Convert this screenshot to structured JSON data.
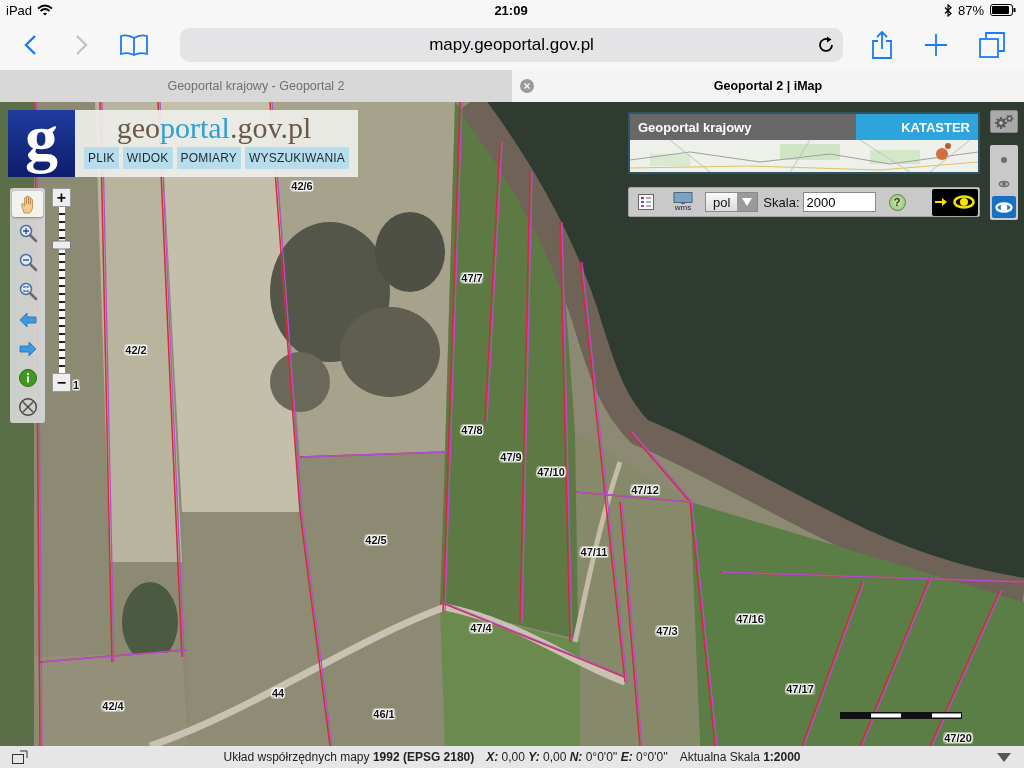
{
  "status_bar": {
    "device": "iPad",
    "time": "21:09",
    "battery": "87%"
  },
  "browser": {
    "left_buttons": [
      {
        "kind": "back",
        "disabled": false
      },
      {
        "kind": "forward",
        "disabled": true
      },
      {
        "kind": "bookmarks",
        "disabled": false
      }
    ],
    "address": "mapy.geoportal.gov.pl",
    "right_buttons": [
      {
        "kind": "share"
      },
      {
        "kind": "new_tab"
      },
      {
        "kind": "tabs"
      }
    ]
  },
  "tabs": [
    {
      "label": "Geoportal krajowy - Geoportal 2",
      "selected": false
    },
    {
      "label": "Geoportal 2 | iMap",
      "selected": true
    }
  ],
  "map": {
    "logo": {
      "mark": "g",
      "wordmark": [
        "geo",
        "portal",
        ".gov.pl"
      ]
    },
    "menu": [
      "PLIK",
      "WIDOK",
      "POMIARY",
      "WYSZUKIWANIA"
    ],
    "tools": [
      {
        "kind": "pan",
        "selected": true
      },
      {
        "kind": "zoom_in",
        "selected": false
      },
      {
        "kind": "zoom_out",
        "selected": false
      },
      {
        "kind": "zoom_extent",
        "selected": false
      },
      {
        "kind": "previous",
        "selected": false
      },
      {
        "kind": "next",
        "selected": false
      },
      {
        "kind": "info",
        "selected": false
      },
      {
        "kind": "clear",
        "selected": false
      }
    ],
    "zoom_slider": {
      "plus": "+",
      "minus": "−",
      "level": 0.77
    },
    "base_maps": [
      {
        "label": "Geoportal krajowy",
        "selected": false
      },
      {
        "label": "KATASTER",
        "selected": true
      }
    ],
    "toolbar": {
      "wms": "wms",
      "language": "pol",
      "scale_label": "Skala:",
      "scale_value": "2000",
      "help": "?"
    },
    "view_buttons": [
      {
        "kind": "dot",
        "selected": false
      },
      {
        "kind": "eye_small",
        "selected": false
      },
      {
        "kind": "eye",
        "selected": true
      }
    ],
    "parcel_labels": [
      "42/6",
      "42/2",
      "1",
      "47/7",
      "47/8",
      "47/9",
      "47/10",
      "47/12",
      "42/5",
      "47/11",
      "47/4",
      "47/3",
      "47/16",
      "44",
      "42/4",
      "46/1",
      "47/17",
      "47/20"
    ]
  },
  "map_status_bar": {
    "coordinate_system": "Układ współrzędnych mapy **1992 (EPSG 2180)**",
    "coordinates": "**X:** 0,00 **Y:** 0,00 **N:** 0°0'0'' **E:** 0°0'0''",
    "scale": "Aktualna Skala **1:2000**"
  }
}
